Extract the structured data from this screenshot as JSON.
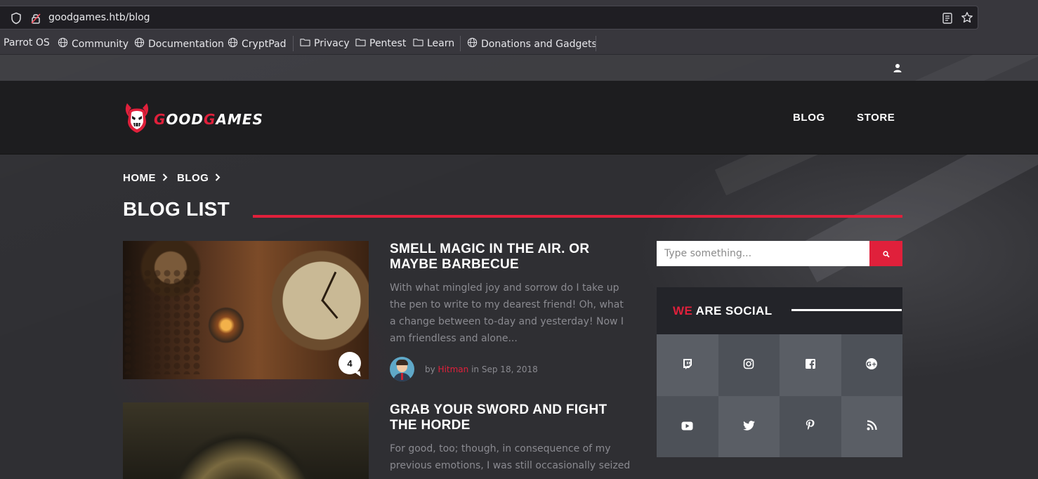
{
  "browser": {
    "url": "goodgames.htb/blog",
    "bookmarks": [
      {
        "label": "Parrot OS",
        "icon": "parrot-icon"
      },
      {
        "label": "Community",
        "icon": "globe-icon"
      },
      {
        "label": "Documentation",
        "icon": "globe-icon"
      },
      {
        "label": "CryptPad",
        "icon": "globe-icon"
      },
      {
        "label": "Privacy",
        "icon": "folder-icon"
      },
      {
        "label": "Pentest",
        "icon": "folder-icon"
      },
      {
        "label": "Learn",
        "icon": "folder-icon"
      },
      {
        "label": "Donations and Gadgets",
        "icon": "globe-icon"
      }
    ]
  },
  "site": {
    "logo": {
      "part1_red": "G",
      "part2": "OOD",
      "part3_red": "G",
      "part4": "AMES"
    },
    "nav": {
      "blog": "BLOG",
      "store": "STORE"
    },
    "breadcrumb": {
      "home": "HOME",
      "blog": "BLOG"
    },
    "page_title": "BLOG LIST",
    "posts": [
      {
        "title": "SMELL MAGIC IN THE AIR. OR MAYBE BARBECUE",
        "excerpt": "With what mingled joy and sorrow do I take up the pen to write to my dearest friend! Oh, what a change between to-day and yesterday! Now I am friendless and alone...",
        "comments": "4",
        "by": "by",
        "author": "Hitman",
        "in": "in",
        "date": "Sep 18, 2018"
      },
      {
        "title": "GRAB YOUR SWORD AND FIGHT THE HORDE",
        "excerpt": "For good, too; though, in consequence of my previous emotions, I was still occasionally seized"
      }
    ],
    "search": {
      "placeholder": "Type something..."
    },
    "social": {
      "title_red": "WE",
      "title_rest": " ARE SOCIAL",
      "icons": [
        "twitch-icon",
        "instagram-icon",
        "facebook-icon",
        "google-plus-icon",
        "youtube-icon",
        "twitter-icon",
        "pinterest-icon",
        "rss-icon"
      ]
    }
  },
  "colors": {
    "accent": "#e0203b",
    "nav_bg": "#1d1d1f",
    "page_bg": "#2f2f33"
  }
}
